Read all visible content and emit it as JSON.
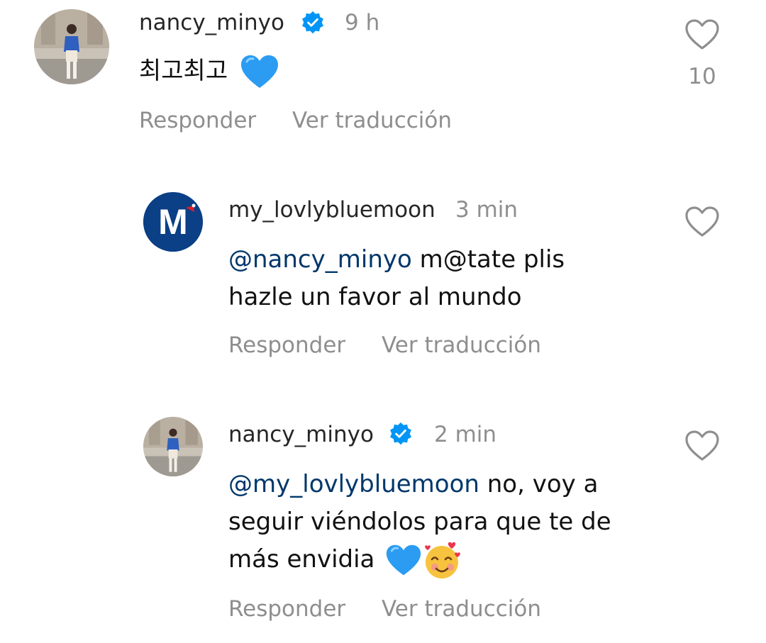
{
  "colors": {
    "text": "#262626",
    "secondary": "#8e8e8e",
    "mention": "#00376b",
    "verified": "#0095f6",
    "heart_blue": "#2b9cf2"
  },
  "icons": {
    "verified": "verified-badge-icon",
    "like": "heart-outline-icon",
    "blue_heart": "blue-heart-emoji",
    "smiling_hearts": "smiling-face-with-hearts-emoji"
  },
  "comments": [
    {
      "username": "nancy_minyo",
      "verified": true,
      "time": "9 h",
      "text": "최고최고",
      "like_count": "10",
      "reply_label": "Responder",
      "translate_label": "Ver traducción"
    },
    {
      "username": "my_lovlybluemoon",
      "verified": false,
      "time": "3 min",
      "mention": "@nancy_minyo",
      "text_line1": " m@tate plis",
      "text_line2": "hazle un favor al mundo",
      "reply_label": "Responder",
      "translate_label": "Ver traducción"
    },
    {
      "username": "nancy_minyo",
      "verified": true,
      "time": "2 min",
      "mention": "@my_lovlybluemoon",
      "text_line1": " no, voy a",
      "text_line2": "seguir viéndolos para que te de",
      "text_line3": "más envidia",
      "reply_label": "Responder",
      "translate_label": "Ver traducción"
    }
  ]
}
